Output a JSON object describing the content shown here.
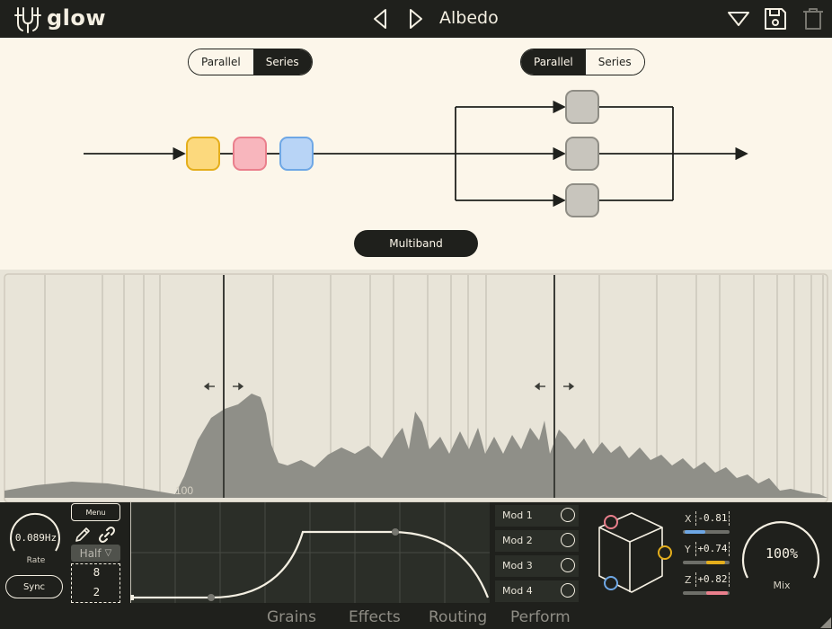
{
  "header": {
    "logo_text": "glow",
    "preset_name": "Albedo",
    "icons": [
      "logo-glyph-icon",
      "chevron-left-icon",
      "chevron-right-icon",
      "dropdown-triangle-icon",
      "save-icon",
      "trash-icon"
    ]
  },
  "routing": {
    "left_toggle": {
      "options": [
        "Parallel",
        "Series"
      ],
      "selected": "Series"
    },
    "right_toggle": {
      "options": [
        "Parallel",
        "Series"
      ],
      "selected": "Parallel"
    },
    "series_nodes": [
      {
        "color": "#fcd97d",
        "border": "#e4ae1c"
      },
      {
        "color": "#f8b6bd",
        "border": "#ea7f8c"
      },
      {
        "color": "#b8d4f6",
        "border": "#6ea7e5"
      }
    ],
    "parallel_nodes_color": "#c8c5bd",
    "multiband_label": "Multiband"
  },
  "spectrum": {
    "crossovers": 2,
    "axis_text": "100"
  },
  "lfo": {
    "menu_label": "Menu",
    "rate_value": "0.089Hz",
    "rate_label": "Rate",
    "sync_label": "Sync",
    "division": "Half",
    "grid_x": "8",
    "grid_y": "2"
  },
  "mods": [
    "Mod 1",
    "Mod 2",
    "Mod 3",
    "Mod 4"
  ],
  "xyz": {
    "x_label": "X",
    "x_value": "-0.81",
    "x_color": "#6ea7e5",
    "x_amount": 0.45,
    "y_label": "Y",
    "y_value": "+0.74",
    "y_color": "#e4ae1c",
    "y_amount": 0.45,
    "z_label": "Z",
    "z_value": "+0.82",
    "z_color": "#ea7f8c",
    "z_amount": 0.5
  },
  "mix": {
    "value": "100%",
    "label": "Mix",
    "amount": 1.0
  },
  "tabs": [
    "Grains",
    "Effects",
    "Routing",
    "Perform"
  ]
}
